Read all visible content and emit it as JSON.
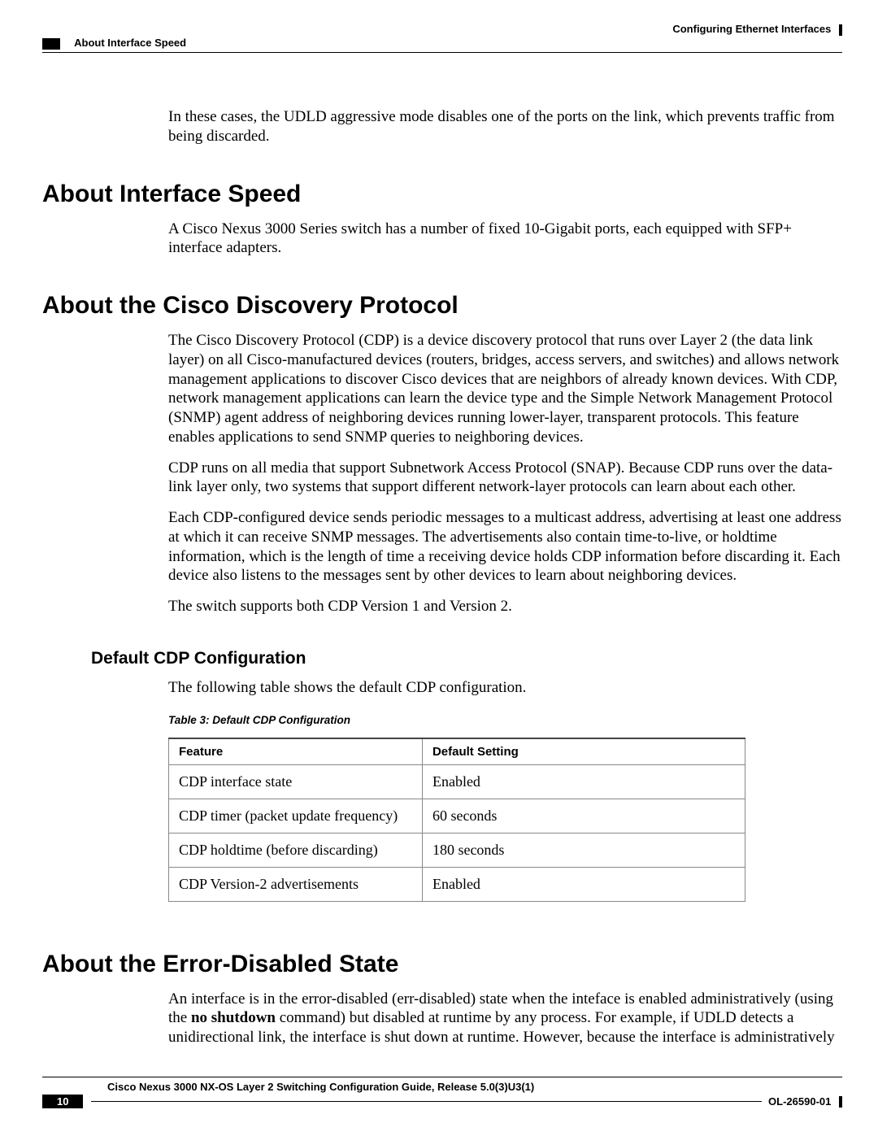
{
  "header": {
    "chapter": "Configuring Ethernet Interfaces",
    "section": "About Interface Speed"
  },
  "intro_para": "In these cases, the UDLD aggressive mode disables one of the ports on the link, which prevents traffic from being discarded.",
  "speed": {
    "heading": "About Interface Speed",
    "para": "A Cisco Nexus 3000 Series switch has a number of fixed 10-Gigabit ports, each equipped with SFP+ interface adapters."
  },
  "cdp": {
    "heading": "About the Cisco Discovery Protocol",
    "p1": "The Cisco Discovery Protocol (CDP) is a device discovery protocol that runs over Layer 2 (the data link layer) on all Cisco-manufactured devices (routers, bridges, access servers, and switches) and allows network management applications to discover Cisco devices that are neighbors of already known devices. With CDP, network management applications can learn the device type and the Simple Network Management Protocol (SNMP) agent address of neighboring devices running lower-layer, transparent protocols. This feature enables applications to send SNMP queries to neighboring devices.",
    "p2": "CDP runs on all media that support Subnetwork Access Protocol (SNAP). Because CDP runs over the data-link layer only, two systems that support different network-layer protocols can learn about each other.",
    "p3": "Each CDP-configured device sends periodic messages to a multicast address, advertising at least one address at which it can receive SNMP messages. The advertisements also contain time-to-live, or holdtime information, which is the length of time a receiving device holds CDP information before discarding it. Each device also listens to the messages sent by other devices to learn about neighboring devices.",
    "p4": "The switch supports both CDP Version 1 and Version 2.",
    "default": {
      "heading": "Default CDP Configuration",
      "intro": "The following table shows the default CDP configuration.",
      "caption": "Table 3: Default CDP Configuration",
      "col1": "Feature",
      "col2": "Default Setting",
      "rows": [
        {
          "feature": "CDP interface state",
          "setting": "Enabled"
        },
        {
          "feature": "CDP timer (packet update frequency)",
          "setting": "60 seconds"
        },
        {
          "feature": "CDP holdtime (before discarding)",
          "setting": "180 seconds"
        },
        {
          "feature": "CDP Version-2 advertisements",
          "setting": "Enabled"
        }
      ]
    }
  },
  "err": {
    "heading": "About the Error-Disabled State",
    "p1_a": "An interface is in the error-disabled (err-disabled) state when the inteface is enabled administratively (using the ",
    "p1_bold": "no shutdown",
    "p1_b": " command) but disabled at runtime by any process. For example, if UDLD detects a unidirectional link, the interface is shut down at runtime. However, because the interface is administratively"
  },
  "footer": {
    "title": "Cisco Nexus 3000 NX-OS Layer 2 Switching Configuration Guide, Release 5.0(3)U3(1)",
    "page": "10",
    "docnum": "OL-26590-01"
  }
}
